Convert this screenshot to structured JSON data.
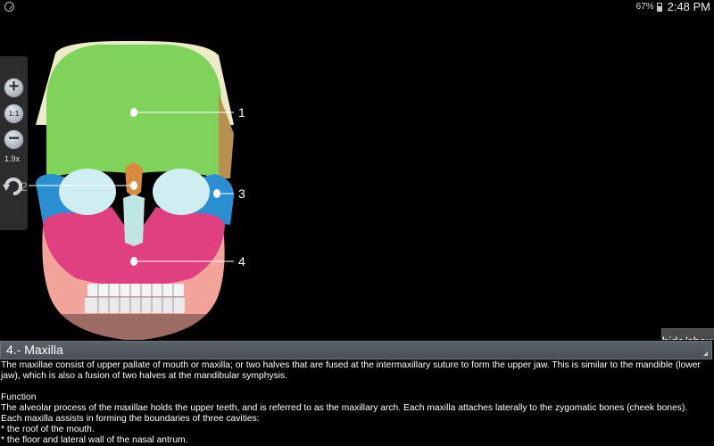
{
  "status_bar": {
    "battery": "67%",
    "time": "2:48 PM"
  },
  "zoom": {
    "plus": "+",
    "one_to_one": "1:1",
    "minus": "−",
    "level": "1.9x"
  },
  "labels": [
    "1",
    "2",
    "3",
    "4"
  ],
  "hide_show_label": "hide/show",
  "section": {
    "title": "4.- Maxilla",
    "intro": "The maxillae consist of upper pallate of mouth or maxilla; or two halves that are fused at the intermaxillary suture to form the upper jaw. This is similar to the mandible (lower jaw), which is also a fusion of two halves at the mandibular symphysis.",
    "function_heading": "Function",
    "function_text": "The alveolar process of the maxillae holds the upper teeth, and is referred to as the maxillary arch. Each maxilla attaches laterally to the zygomatic bones (cheek bones).",
    "cavities_intro": "Each maxilla assists in forming the boundaries of three cavities:",
    "cavities": [
      "* the roof of the mouth.",
      "* the floor and lateral wall of the nasal antrum."
    ]
  },
  "colors": {
    "frontal": "#7fd35a",
    "maxilla": "#e0407f",
    "zygomatic": "#2a8fd0",
    "nasal": "#d98a3c",
    "mandible": "#f2a39a",
    "orbit": "#cfeef2",
    "cranium_top": "#ecebc8"
  }
}
